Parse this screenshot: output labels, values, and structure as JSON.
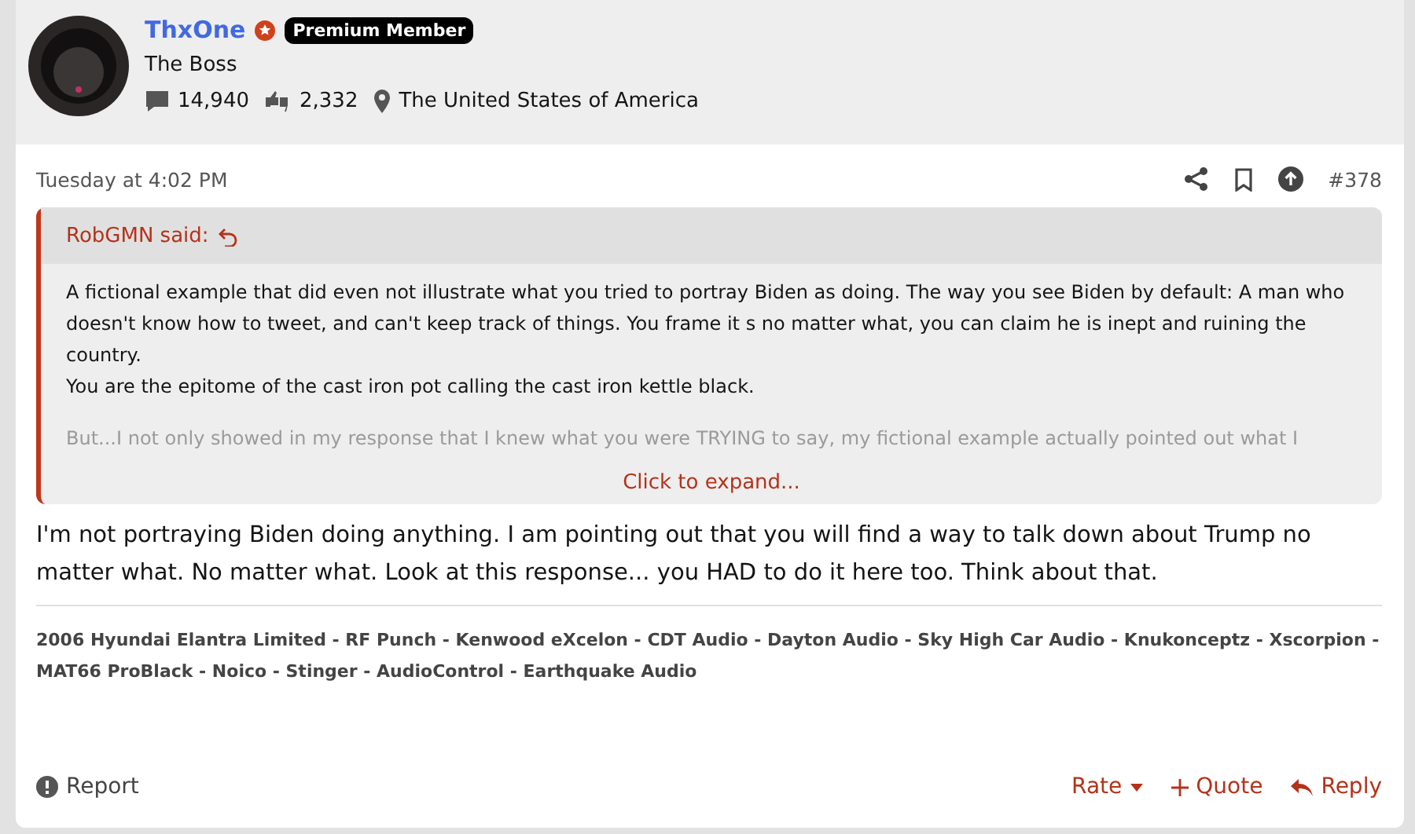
{
  "author": {
    "name": "ThxOne",
    "badge": "Premium Member",
    "title": "The Boss",
    "messages": "14,940",
    "reactions": "2,332",
    "location": "The United States of America"
  },
  "post": {
    "date": "Tuesday at 4:02 PM",
    "number": "#378",
    "quote": {
      "author": "RobGMN said:",
      "paragraphs": [
        "A fictional example that did even not illustrate what you tried to portray Biden as doing. The way you see Biden by default: A man who doesn't know how to tweet, and can't keep track of things. You frame it s no matter what, you can claim he is inept and ruining the country.\nYou are the epitome of the cast iron pot calling the cast iron kettle black.",
        "But...I not only showed in my response that I knew what you were TRYING to say, my fictional example actually pointed out what I"
      ],
      "expand": "Click to expand..."
    },
    "body": "I'm not portraying Biden doing anything. I am pointing out that you will find a way to talk down about Trump no matter what. No matter what. Look at this response... you HAD to do it here too. Think about that.",
    "signature": "2006 Hyundai Elantra Limited - RF Punch - Kenwood eXcelon - CDT Audio - Dayton Audio - Sky High Car Audio - Knukonceptz - Xscorpion - MAT66 ProBlack - Noico - Stinger - AudioControl - Earthquake Audio"
  },
  "actions": {
    "report": "Report",
    "rate": "Rate",
    "quote": "Quote",
    "reply": "Reply"
  }
}
